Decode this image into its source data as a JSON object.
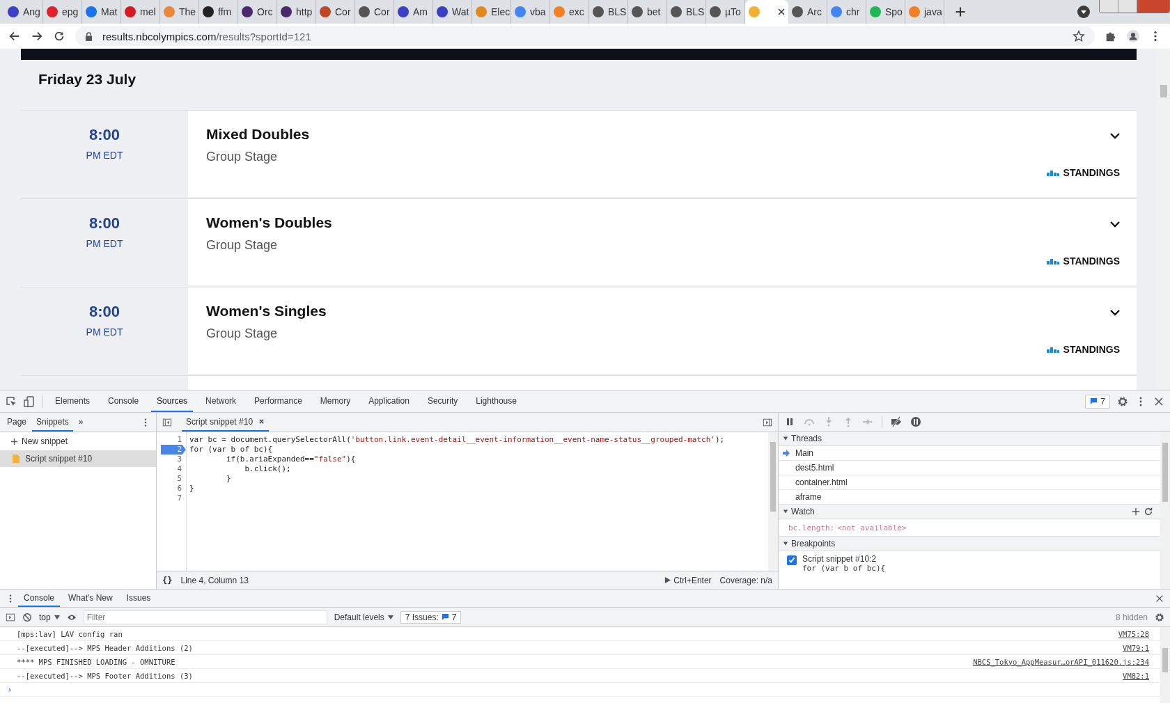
{
  "browser": {
    "tabs": [
      {
        "title": "Ang",
        "color": "#3b3fc4",
        "selected": false
      },
      {
        "title": "epg",
        "color": "#e0202a",
        "selected": false
      },
      {
        "title": "Mat",
        "color": "#1a73e8",
        "selected": false
      },
      {
        "title": "mel",
        "color": "#d71920",
        "selected": false
      },
      {
        "title": "The",
        "color": "#e8883a",
        "selected": false
      },
      {
        "title": "ffm",
        "color": "#222222",
        "selected": false
      },
      {
        "title": "Orc",
        "color": "#4a2a6a",
        "selected": false
      },
      {
        "title": "http",
        "color": "#4a2a6a",
        "selected": false
      },
      {
        "title": "Cor",
        "color": "#c0462a",
        "selected": false
      },
      {
        "title": "Cor",
        "color": "#555555",
        "selected": false
      },
      {
        "title": "Am",
        "color": "#3b3fc4",
        "selected": false
      },
      {
        "title": "Wat",
        "color": "#3b3fc4",
        "selected": false
      },
      {
        "title": "Elec",
        "color": "#e08a1e",
        "selected": false
      },
      {
        "title": "vba",
        "color": "#4285f4",
        "selected": false
      },
      {
        "title": "exc",
        "color": "#f48024",
        "selected": false
      },
      {
        "title": "BLS",
        "color": "#555555",
        "selected": false
      },
      {
        "title": "bet",
        "color": "#555555",
        "selected": false
      },
      {
        "title": "BLS",
        "color": "#555555",
        "selected": false
      },
      {
        "title": "µTo",
        "color": "#555555",
        "selected": false
      },
      {
        "color": "#f2b134",
        "selected": true
      },
      {
        "title": "Arc",
        "color": "#555555",
        "selected": false
      },
      {
        "title": "chr",
        "color": "#4285f4",
        "selected": false
      },
      {
        "title": "Spo",
        "color": "#1db954",
        "selected": false
      },
      {
        "title": "java",
        "color": "#f48024",
        "selected": false
      }
    ],
    "url_host": "results.nbcolympics.com",
    "url_path": "/results?sportId=121"
  },
  "page": {
    "date": "Friday 23 July",
    "events": [
      {
        "time": "8:00",
        "zone": "PM EDT",
        "name": "Mixed Doubles",
        "stage": "Group Stage",
        "link": "STANDINGS"
      },
      {
        "time": "8:00",
        "zone": "PM EDT",
        "name": "Women's Doubles",
        "stage": "Group Stage",
        "link": "STANDINGS"
      },
      {
        "time": "8:00",
        "zone": "PM EDT",
        "name": "Women's Singles",
        "stage": "Group Stage",
        "link": "STANDINGS"
      }
    ]
  },
  "devtools": {
    "tabs": [
      {
        "label": "Elements",
        "selected": false
      },
      {
        "label": "Console",
        "selected": false
      },
      {
        "label": "Sources",
        "selected": true
      },
      {
        "label": "Network",
        "selected": false
      },
      {
        "label": "Performance",
        "selected": false
      },
      {
        "label": "Memory",
        "selected": false
      },
      {
        "label": "Application",
        "selected": false
      },
      {
        "label": "Security",
        "selected": false
      },
      {
        "label": "Lighthouse",
        "selected": false
      }
    ],
    "issues_count": "7",
    "navigator": {
      "tabs": [
        {
          "label": "Page",
          "selected": false
        },
        {
          "label": "Snippets",
          "selected": true
        }
      ],
      "more": "»",
      "new_snippet": "New snippet",
      "items": [
        {
          "label": "Script snippet #10",
          "selected": true
        }
      ]
    },
    "editor": {
      "tab": "Script snippet #10",
      "lines": [
        {
          "number": "1",
          "breakpoint": false,
          "parts": [
            {
              "text": "var bc = document.querySelectorAll(",
              "kind": "code"
            },
            {
              "text": "'button.link.event-detail__event-information__event-name-status__grouped-match'",
              "kind": "string"
            },
            {
              "text": ");",
              "kind": "code"
            }
          ]
        },
        {
          "number": "2",
          "breakpoint": true,
          "parts": [
            {
              "text": "for (var b of bc){",
              "kind": "code"
            }
          ]
        },
        {
          "number": "3",
          "breakpoint": false,
          "parts": [
            {
              "text": "        if(b.ariaExpanded==",
              "kind": "code"
            },
            {
              "text": "\"false\"",
              "kind": "string"
            },
            {
              "text": "){",
              "kind": "code"
            }
          ]
        },
        {
          "number": "4",
          "breakpoint": false,
          "parts": [
            {
              "text": "            b.click();",
              "kind": "code"
            }
          ]
        },
        {
          "number": "5",
          "breakpoint": false,
          "parts": [
            {
              "text": "        }",
              "kind": "code"
            }
          ]
        },
        {
          "number": "6",
          "breakpoint": false,
          "parts": [
            {
              "text": "}",
              "kind": "code"
            }
          ]
        },
        {
          "number": "7",
          "breakpoint": false
        }
      ],
      "format": "{}",
      "position": "Line 4, Column 13",
      "run": "Ctrl+Enter",
      "coverage": "Coverage: n/a"
    },
    "debugger": {
      "threads_title": "Threads",
      "threads": [
        {
          "label": "Main",
          "selected": true
        },
        {
          "label": "dest5.html",
          "selected": false
        },
        {
          "label": "container.html",
          "selected": false
        },
        {
          "label": "aframe",
          "selected": false
        }
      ],
      "watch_title": "Watch",
      "watch": [
        {
          "expr": "bc.length:",
          "value": "<not available>"
        }
      ],
      "breakpoints_title": "Breakpoints",
      "breakpoints": [
        {
          "location": "Script snippet #10:2",
          "code": "for (var b of bc){",
          "checked": true
        }
      ]
    }
  },
  "drawer": {
    "tabs": [
      {
        "label": "Console",
        "selected": true
      },
      {
        "label": "What's New",
        "selected": false
      },
      {
        "label": "Issues",
        "selected": false
      }
    ],
    "context": "top",
    "filter_placeholder": "Filter",
    "levels": "Default levels",
    "issues_label": "7 Issues:",
    "issues_count": "7",
    "hidden": "8 hidden",
    "messages": [
      {
        "text": "[mps:lav] LAV config ran",
        "source": "VM75:28"
      },
      {
        "text": "--[executed]--> MPS Header Additions (2)",
        "source": "VM79:1"
      },
      {
        "text": "**** MPS FINISHED LOADING - OMNITURE",
        "source": "NBCS_Tokyo_AppMeasur…orAPI_011620.js:234"
      },
      {
        "text": "--[executed]--> MPS Footer Additions (3)",
        "source": "VM82:1"
      }
    ],
    "prompt": "›"
  }
}
